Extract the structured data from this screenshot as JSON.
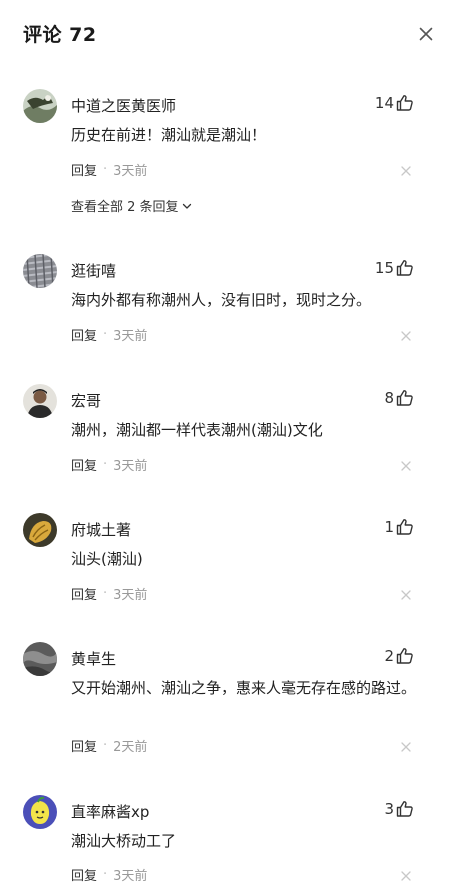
{
  "header": {
    "title": "评论 72"
  },
  "icons": {
    "close": "close-icon",
    "like": "thumbs-up-icon",
    "delete": "x-icon",
    "expand": "chevron-down-icon"
  },
  "colors": {
    "text": "#222222",
    "muted": "#999999",
    "icon": "#333333"
  },
  "reply_label": "回复",
  "separator": "·",
  "comments": [
    {
      "username": "中道之医黄医师",
      "likes": "14",
      "text": "历史在前进！潮汕就是潮汕！",
      "time": "3天前",
      "view_replies": "查看全部 2 条回复"
    },
    {
      "username": "逛街嘻",
      "likes": "15",
      "text": "海内外都有称潮州人，没有旧时，现时之分。",
      "time": "3天前"
    },
    {
      "username": "宏哥",
      "likes": "8",
      "text": "潮州，潮汕都一样代表潮州(潮汕)文化",
      "time": "3天前"
    },
    {
      "username": "府城土著",
      "likes": "1",
      "text": "汕头(潮汕)",
      "time": "3天前"
    },
    {
      "username": "黄卓生",
      "likes": "2",
      "text": "又开始潮州、潮汕之争，惠来人毫无存在感的路过。",
      "time": "2天前"
    },
    {
      "username": "直率麻酱xp",
      "likes": "3",
      "text": "潮汕大桥动工了",
      "time": "3天前"
    }
  ]
}
